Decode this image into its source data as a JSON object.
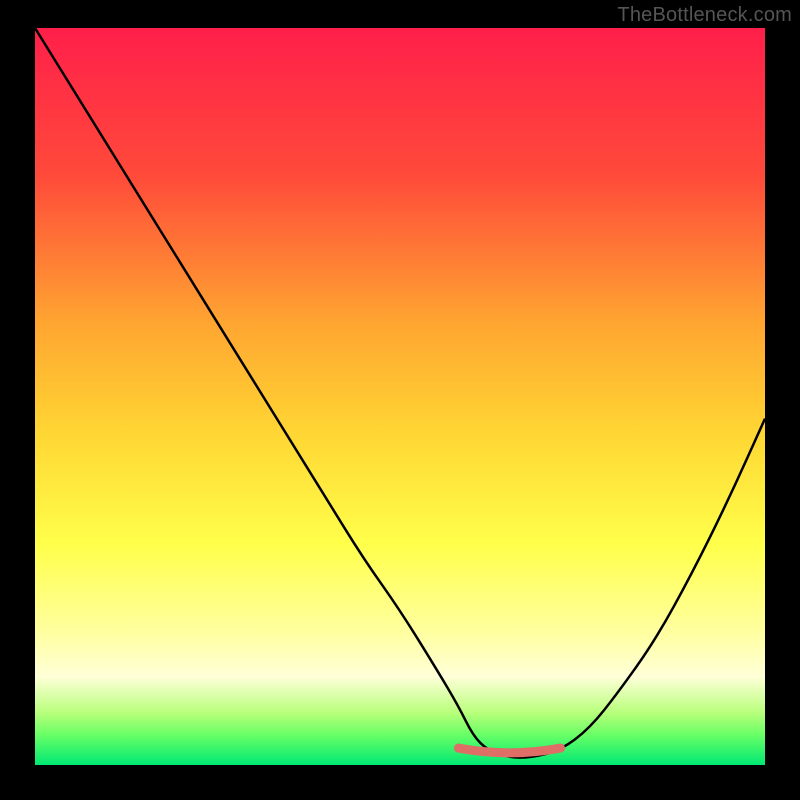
{
  "watermark": "TheBottleneck.com",
  "chart_data": {
    "type": "line",
    "title": "",
    "xlabel": "",
    "ylabel": "",
    "xlim": [
      0,
      100
    ],
    "ylim": [
      0,
      100
    ],
    "grid": false,
    "legend": false,
    "series": [
      {
        "name": "curve",
        "color": "#000000",
        "x": [
          0,
          5,
          10,
          15,
          20,
          25,
          30,
          35,
          40,
          45,
          50,
          55,
          58,
          60,
          62,
          65,
          68,
          72,
          76,
          80,
          85,
          90,
          95,
          100
        ],
        "y": [
          100,
          92,
          84,
          76,
          68,
          60,
          52,
          44,
          36,
          28,
          21,
          13,
          8,
          4,
          2,
          1,
          1,
          2,
          5,
          10,
          17,
          26,
          36,
          47
        ]
      },
      {
        "name": "flat-segment",
        "color": "#de6e66",
        "x": [
          58,
          72
        ],
        "y": [
          1.5,
          1.5
        ]
      }
    ],
    "gradient_bands": [
      {
        "y": 0,
        "color": "#ff1f4a"
      },
      {
        "y": 20,
        "color": "#ff4a3a"
      },
      {
        "y": 40,
        "color": "#ffa531"
      },
      {
        "y": 55,
        "color": "#ffd633"
      },
      {
        "y": 70,
        "color": "#ffff4a"
      },
      {
        "y": 82,
        "color": "#ffffa0"
      },
      {
        "y": 88,
        "color": "#ffffd8"
      },
      {
        "y": 93,
        "color": "#b6ff7a"
      },
      {
        "y": 96,
        "color": "#66ff66"
      },
      {
        "y": 100,
        "color": "#00e873"
      }
    ]
  }
}
